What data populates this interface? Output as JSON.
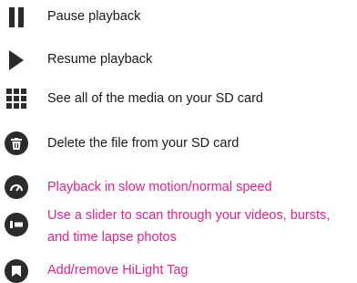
{
  "legend": {
    "items": [
      {
        "icon": "pause-icon",
        "label": "Pause playback",
        "color": "#1a1a1a"
      },
      {
        "icon": "play-icon",
        "label": "Resume playback",
        "color": "#1a1a1a"
      },
      {
        "icon": "grid-icon",
        "label": "See all of the media on your SD card",
        "color": "#1a1a1a"
      },
      {
        "icon": "trash-icon",
        "label": "Delete the file from your SD card",
        "color": "#1a1a1a"
      },
      {
        "icon": "speedometer-icon",
        "label": "Playback in slow motion/normal speed",
        "color": "#e8218a"
      },
      {
        "icon": "slider-icon",
        "label_line1": "Use a slider to scan through your videos, bursts,",
        "label_line2": "and time lapse photos",
        "color": "#e8218a"
      },
      {
        "icon": "hilight-tag-icon",
        "label": "Add/remove HiLight Tag",
        "color": "#e8218a"
      }
    ]
  }
}
